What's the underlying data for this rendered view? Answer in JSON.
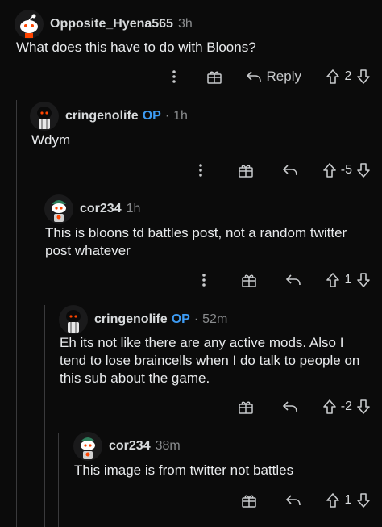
{
  "comments": [
    {
      "username": "Opposite_Hyena565",
      "op": false,
      "op_label": "",
      "time": "3h",
      "body": "What does this have to do with Bloons?",
      "reply_label": "Reply",
      "score": "2"
    },
    {
      "username": "cringenolife",
      "op": true,
      "op_label": "OP",
      "time": "1h",
      "body": "Wdym",
      "reply_label": "",
      "score": "-5"
    },
    {
      "username": "cor234",
      "op": false,
      "op_label": "",
      "time": "1h",
      "body": "This is bloons td battles post, not a random twitter post whatever",
      "reply_label": "",
      "score": "1"
    },
    {
      "username": "cringenolife",
      "op": true,
      "op_label": "OP",
      "time": "52m",
      "body": "Eh its not like there are any active mods. Also I tend to lose braincells when I do talk to people on this sub about the game.",
      "reply_label": "",
      "score": "-2"
    },
    {
      "username": "cor234",
      "op": false,
      "op_label": "",
      "time": "38m",
      "body": "This image is from twitter not battles",
      "reply_label": "",
      "score": "1"
    }
  ],
  "icons": {
    "more": "more-options-icon",
    "award": "award-icon",
    "reply": "reply-arrow-icon",
    "upvote": "upvote-arrow-icon",
    "downvote": "downvote-arrow-icon"
  },
  "colors": {
    "background": "#0b0b0b",
    "op_badge": "#3d9bf3",
    "muted": "#8a8c8e",
    "thread_line": "#3a3a3c"
  }
}
